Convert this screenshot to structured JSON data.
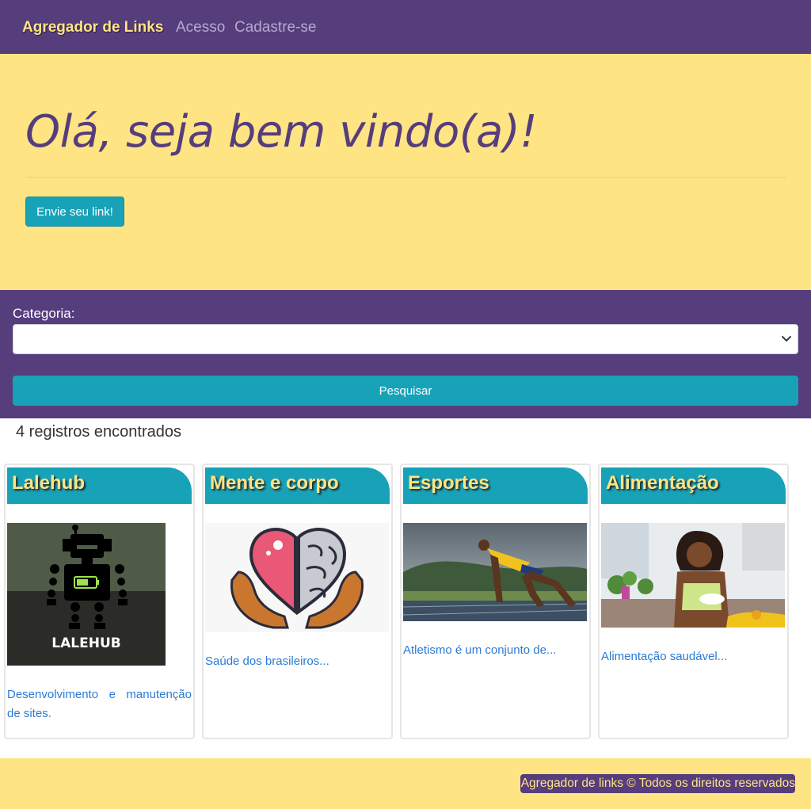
{
  "navbar": {
    "brand": "Agregador de Links",
    "links": [
      "Acesso",
      "Cadastre-se"
    ]
  },
  "hero": {
    "title": "Olá, seja bem vindo(a)!",
    "button_label": "Envie seu link!"
  },
  "search": {
    "label": "Categoria:",
    "selected_value": "",
    "button_label": "Pesquisar"
  },
  "results": {
    "count_text": "4 registros encontrados"
  },
  "cards": [
    {
      "title": "Lalehub",
      "image": "lalehub-robot-logo",
      "image_text": "LALEHUB",
      "description": "Desenvolvimento e manutenção de sites."
    },
    {
      "title": "Mente e corpo",
      "image": "heart-brain-hands",
      "description": "Saúde dos brasileiros..."
    },
    {
      "title": "Esportes",
      "image": "sprinter-on-track",
      "description": "Atletismo é um conjunto de..."
    },
    {
      "title": "Alimentação",
      "image": "woman-eating-salad",
      "description": "Alimentação saudável..."
    }
  ],
  "footer": {
    "text": "Agregador de links © Todos os direitos reservados"
  },
  "colors": {
    "primary_purple": "#563d7c",
    "accent_yellow": "#ffe484",
    "info_teal": "#17a2b8",
    "link_blue": "#2a7bd6"
  }
}
